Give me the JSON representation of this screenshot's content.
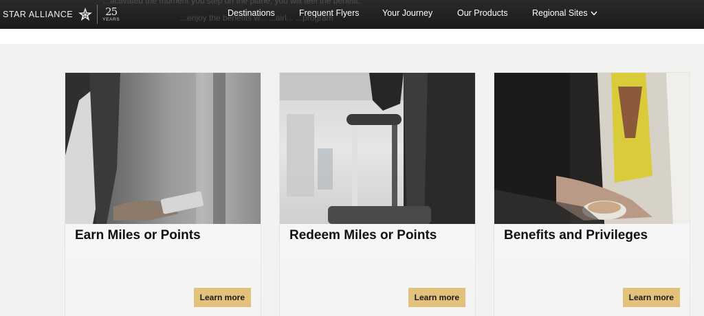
{
  "header": {
    "brand_name": "STAR ALLIANCE",
    "anniversary_number": "25",
    "anniversary_word": "YEARS",
    "background_text_1": "...activated the moment you step on the plane, you will feel the benefit.",
    "background_text_2": "...enjoy the benefits w...   ...airl...   ...program",
    "nav": [
      {
        "label": "Destinations"
      },
      {
        "label": "Frequent Flyers"
      },
      {
        "label": "Your Journey"
      },
      {
        "label": "Our Products"
      },
      {
        "label": "Regional Sites",
        "icon": "chevron-down-icon"
      }
    ]
  },
  "cards": [
    {
      "title": "Earn Miles or Points",
      "button": "Learn more",
      "image": "traveler-holding-phone"
    },
    {
      "title": "Redeem Miles or Points",
      "button": "Learn more",
      "image": "rolling-suitcase-airport"
    },
    {
      "title": "Benefits and Privileges",
      "button": "Learn more",
      "image": "woman-with-coffee-cup"
    }
  ],
  "colors": {
    "header_bg": "#1f1f1f",
    "button_bg": "#e3c17a",
    "page_bg": "#f2f2f0"
  }
}
